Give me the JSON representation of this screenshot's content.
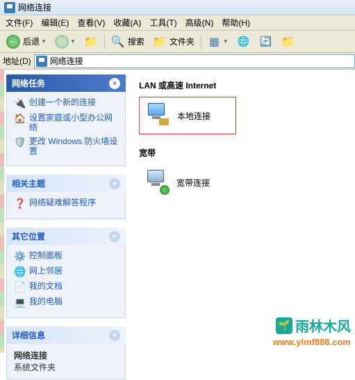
{
  "title": "网络连接",
  "menu": {
    "file": "文件(F)",
    "edit": "编辑(E)",
    "view": "查看(V)",
    "favorites": "收藏(A)",
    "tools": "工具(T)",
    "advanced": "高级(N)",
    "help": "帮助(H)"
  },
  "toolbar": {
    "back": "后退",
    "search": "搜索",
    "folders": "文件夹"
  },
  "addressbar": {
    "label": "地址(D)",
    "value": "网络连接"
  },
  "sidebar": {
    "tasks": {
      "title": "网络任务",
      "items": [
        "创建一个新的连接",
        "设置家庭或小型办公网络",
        "更改 Windows 防火墙设置"
      ]
    },
    "related": {
      "title": "相关主题",
      "items": [
        "网络疑难解答程序"
      ]
    },
    "other": {
      "title": "其它位置",
      "items": [
        "控制面板",
        "网上邻居",
        "我的文档",
        "我的电脑"
      ]
    },
    "details": {
      "title": "详细信息",
      "name": "网络连接",
      "type": "系统文件夹"
    }
  },
  "main": {
    "group_lan": "LAN 或高速 Internet",
    "item_lan": "本地连接",
    "group_broadband": "宽带",
    "item_broadband": "宽带连接"
  },
  "watermark": {
    "brand": "雨林木风",
    "url": "www.ylmf888.com"
  }
}
